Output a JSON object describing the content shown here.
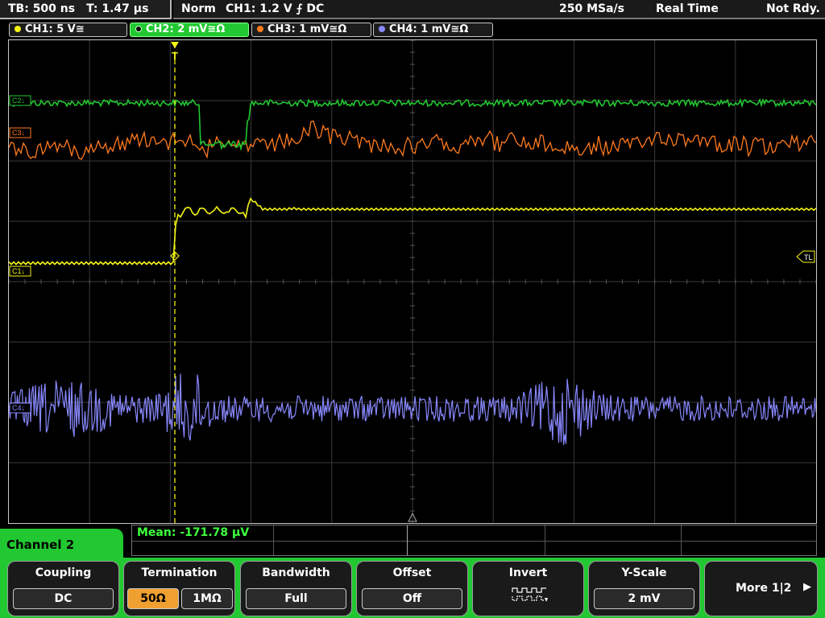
{
  "top": {
    "tb": "TB: 500 ns",
    "t": "T: 1.47 µs",
    "mode": "Norm",
    "trigger": "CH1: 1.2 V ⨍ DC",
    "sample_rate": "250 MSa/s",
    "acq": "Real Time",
    "status": "Not Rdy."
  },
  "channels": [
    {
      "label": "CH1: 5 V≅",
      "color": "#f5f516"
    },
    {
      "label": "CH2: 2 mV≅Ω",
      "color": "#22c831"
    },
    {
      "label": "CH3: 1 mV≅Ω",
      "color": "#ff7a1f"
    },
    {
      "label": "CH4: 1 mV≅Ω",
      "color": "#8888ff"
    }
  ],
  "markers": {
    "c2": "C2↓",
    "c3": "C3↓",
    "c1": "C1↓",
    "c4": "C4↓",
    "trigger_level": "TL",
    "trigger_pos": "T"
  },
  "measurement": {
    "mean": "Mean: -171.78 µV"
  },
  "menu": {
    "channel": "Channel 2",
    "coupling": {
      "title": "Coupling",
      "value": "DC"
    },
    "termination": {
      "title": "Termination",
      "opt1": "50Ω",
      "opt2": "1MΩ"
    },
    "bandwidth": {
      "title": "Bandwidth",
      "value": "Full"
    },
    "offset": {
      "title": "Offset",
      "value": "Off"
    },
    "invert": {
      "title": "Invert"
    },
    "yscale": {
      "title": "Y-Scale",
      "value": "2 mV"
    },
    "more": {
      "label": "More 1|2",
      "arrow": "▶"
    }
  }
}
